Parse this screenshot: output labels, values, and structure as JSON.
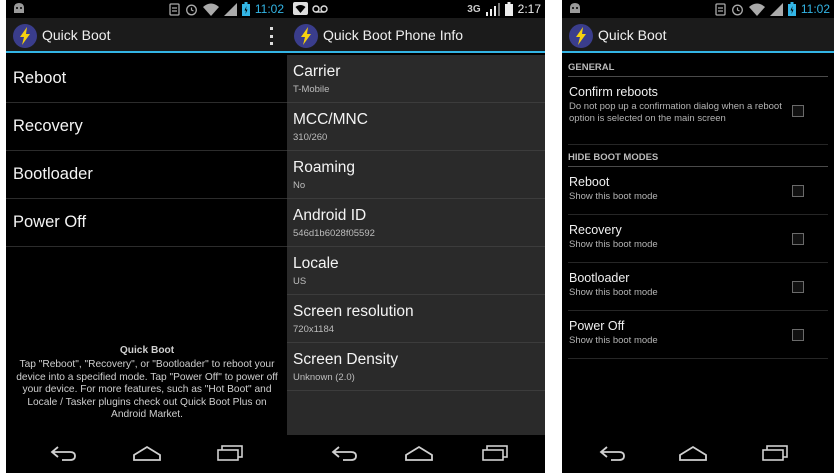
{
  "status": {
    "time_1": "11:02",
    "time_2": "2:17",
    "time_3": "11:02",
    "network_2": "3G"
  },
  "screen1": {
    "title": "Quick Boot",
    "boot_modes": [
      {
        "label": "Reboot"
      },
      {
        "label": "Recovery"
      },
      {
        "label": "Bootloader"
      },
      {
        "label": "Power Off"
      }
    ],
    "about_title": "Quick Boot",
    "about_text": "Tap \"Reboot\", \"Recovery\", or \"Bootloader\" to reboot your device into a specified mode. Tap \"Power Off\" to power off your device. For more features, such as \"Hot Boot\" and Locale / Tasker plugins check out Quick Boot Plus on Android Market."
  },
  "screen2": {
    "title": "Quick Boot Phone Info",
    "items": [
      {
        "label": "Carrier",
        "value": "T-Mobile"
      },
      {
        "label": "MCC/MNC",
        "value": "310/260"
      },
      {
        "label": "Roaming",
        "value": "No"
      },
      {
        "label": "Android ID",
        "value": "546d1b6028f05592"
      },
      {
        "label": "Locale",
        "value": "US"
      },
      {
        "label": "Screen resolution",
        "value": "720x1184"
      },
      {
        "label": "Screen Density",
        "value": "Unknown (2.0)"
      }
    ]
  },
  "screen3": {
    "title": "Quick Boot",
    "general_header": "GENERAL",
    "confirm_title": "Confirm reboots",
    "confirm_summary": "Do not pop up a confirmation dialog when a reboot option is selected on the main screen",
    "hide_header": "HIDE BOOT MODES",
    "hide_items": [
      {
        "title": "Reboot",
        "summary": "Show this boot mode"
      },
      {
        "title": "Recovery",
        "summary": "Show this boot mode"
      },
      {
        "title": "Bootloader",
        "summary": "Show this boot mode"
      },
      {
        "title": "Power Off",
        "summary": "Show this boot mode"
      }
    ]
  },
  "colors": {
    "accent": "#33b5e5",
    "background": "#000000",
    "info_background": "#2a2a2a"
  }
}
